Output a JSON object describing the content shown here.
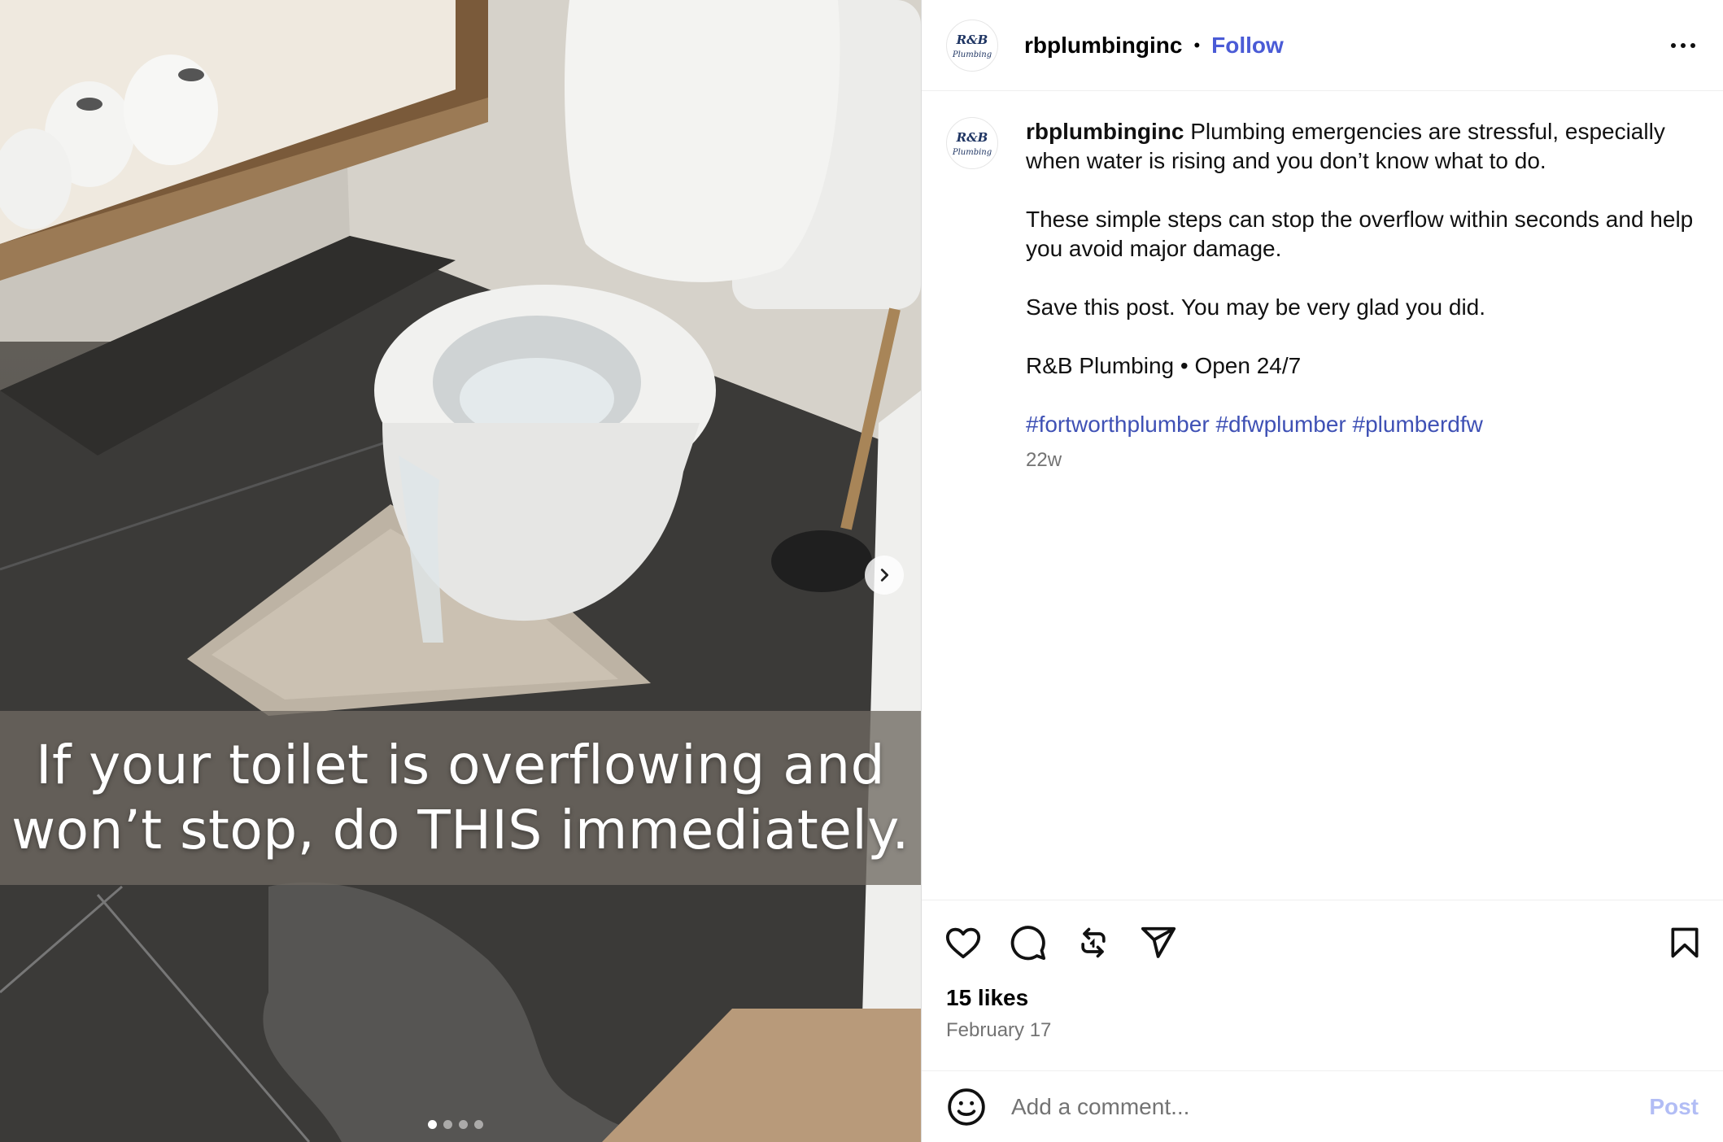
{
  "media": {
    "overlay_text": "If your toilet is overflowing and\nwon’t stop, do THIS immediately.",
    "carousel": {
      "count": 4,
      "active_index": 0
    },
    "next_icon": "chevron-right-icon"
  },
  "header": {
    "avatar_text_top": "R&B",
    "avatar_text_bottom": "Plumbing",
    "username": "rbplumbinginc",
    "separator": "•",
    "follow_label": "Follow",
    "more_icon": "more-options-icon"
  },
  "caption": {
    "username": "rbplumbinginc",
    "paragraphs": [
      "Plumbing emergencies are stressful, especially when water is rising and you don’t know what to do.",
      "These simple steps can stop the overflow within seconds and help you avoid major damage.",
      "Save this post. You may be very glad you did.",
      "R&B Plumbing • Open 24/7"
    ],
    "hashtags": [
      "#fortworthplumber",
      "#dfwplumber",
      "#plumberdfw"
    ],
    "age": "22w"
  },
  "actions": {
    "icons": [
      "heart-icon",
      "comment-icon",
      "repost-icon",
      "share-icon",
      "bookmark-icon"
    ],
    "likes": "15 likes",
    "date": "February 17"
  },
  "comment_bar": {
    "placeholder": "Add a comment...",
    "post_label": "Post",
    "emoji_icon": "emoji-icon"
  },
  "colors": {
    "follow": "#4a5bd6",
    "hashtag": "#3f51b5",
    "post_disabled": "#b2bdf5",
    "muted": "#737373"
  }
}
